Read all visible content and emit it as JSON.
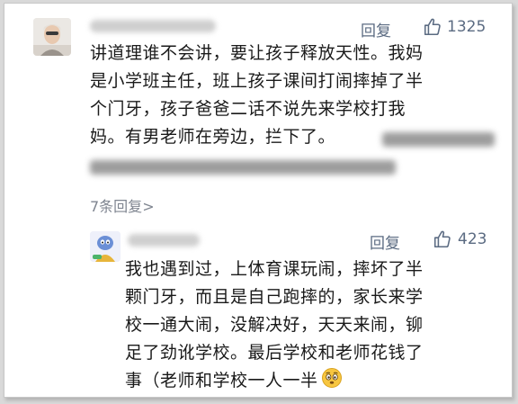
{
  "comment": {
    "reply_label": "回复",
    "like_count": "1325",
    "lines": [
      "讲道理谁不会讲，要让孩子释放天性。我妈",
      "是小学班主任，班上孩子课间打闹摔掉了半",
      "个门牙，孩子爸爸二话不说先来学校打我",
      "妈。有男老师在旁边，拦下了。"
    ],
    "more_replies": "7条回复",
    "more_replies_chevron": ">"
  },
  "reply": {
    "reply_label": "回复",
    "like_count": "423",
    "lines": [
      "我也遇到过，上体育课玩闹，摔坏了半",
      "颗门牙，而且是自己跑摔的，家长来学",
      "校一通大闹，没解决好，天天来闹，铆",
      "足了劲讹学校。最后学校和老师花钱了",
      "事（老师和学校一人一半"
    ],
    "emoji_icon": "worried-face-emoji"
  },
  "colors": {
    "action": "#5b6b82",
    "text": "#1a1a1a",
    "muted": "#7f8590",
    "background": "#ffffff"
  }
}
